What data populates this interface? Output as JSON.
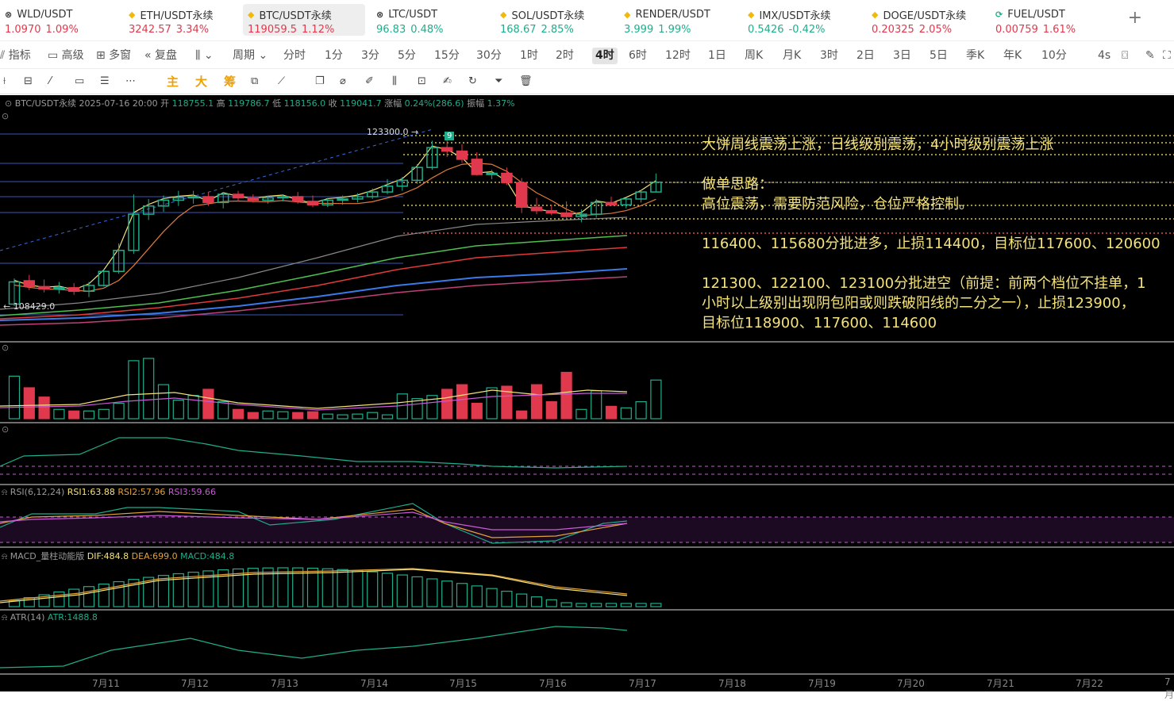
{
  "tickers": [
    {
      "name": "WLD/USDT",
      "price": "1.0970",
      "change": "1.09%",
      "icon": "⊗",
      "icon_color": "#333",
      "color": "#e0394d",
      "active": false
    },
    {
      "name": "ETH/USDT永续",
      "price": "3242.57",
      "change": "3.34%",
      "icon": "◆",
      "icon_color": "#f0b90b",
      "color": "#e0394d",
      "active": false
    },
    {
      "name": "BTC/USDT永续",
      "price": "119059.5",
      "change": "1.12%",
      "icon": "◆",
      "icon_color": "#f0b90b",
      "color": "#e0394d",
      "active": true
    },
    {
      "name": "LTC/USDT",
      "price": "96.83",
      "change": "0.48%",
      "icon": "⊗",
      "icon_color": "#333",
      "color": "#1fad8b",
      "active": false
    },
    {
      "name": "SOL/USDT永续",
      "price": "168.67",
      "change": "2.85%",
      "icon": "◆",
      "icon_color": "#f0b90b",
      "color": "#1fad8b",
      "active": false
    },
    {
      "name": "RENDER/USDT",
      "price": "3.999",
      "change": "1.99%",
      "icon": "◆",
      "icon_color": "#f0b90b",
      "color": "#1fad8b",
      "active": false
    },
    {
      "name": "IMX/USDT永续",
      "price": "0.5426",
      "change": "-0.42%",
      "icon": "◆",
      "icon_color": "#f0b90b",
      "color": "#1fad8b",
      "active": false
    },
    {
      "name": "DOGE/USDT永续",
      "price": "0.20325",
      "change": "2.05%",
      "icon": "◆",
      "icon_color": "#f0b90b",
      "color": "#e0394d",
      "active": false
    },
    {
      "name": "FUEL/USDT",
      "price": "0.00759",
      "change": "1.61%",
      "icon": "⟳",
      "icon_color": "#1fad8b",
      "color": "#e0394d",
      "active": false
    }
  ],
  "toolbar_left": [
    {
      "icon": "⫽",
      "label": "指标"
    },
    {
      "icon": "▭",
      "label": "高级"
    },
    {
      "icon": "⊞",
      "label": "多窗"
    },
    {
      "icon": "«",
      "label": "复盘"
    },
    {
      "icon": "⫼",
      "label": "⌄"
    }
  ],
  "periods_label": "周期 ⌄",
  "timeframes": [
    "分时",
    "1分",
    "3分",
    "5分",
    "15分",
    "30分",
    "1时",
    "2时",
    "4时",
    "6时",
    "12时",
    "1日",
    "周K",
    "月K",
    "3时",
    "2日",
    "3日",
    "5日",
    "季K",
    "年K",
    "10分",
    "4s"
  ],
  "active_timeframe": "4时",
  "draw_labels": {
    "main": "主",
    "big": "大",
    "chip": "筹"
  },
  "legend": {
    "symbol": "BTC/USDT永续",
    "time": "2025-07-16 20:00",
    "open_label": "开",
    "open": "118755.1",
    "high_label": "高",
    "high": "119786.7",
    "low_label": "低",
    "low": "118156.0",
    "close_label": "收",
    "close": "119041.7",
    "change_label": "涨幅",
    "change": "0.24%(286.6)",
    "amp_label": "振幅",
    "amp": "1.37%"
  },
  "price_labels": {
    "high": "123300.0",
    "low": "108429.0",
    "candle_count": "9"
  },
  "annotation": {
    "line1": "大饼周线震荡上涨，日线级别震荡，4小时级别震荡上涨",
    "line2": "做单思路：",
    "line3": "高位震荡，需要防范风险，仓位严格控制。",
    "line4": "116400、115680分批进多，止损114400，目标位117600、120600",
    "line5": "121300、122100、123100分批进空（前提：前两个档位不挂单，1",
    "line6": "小时以上级别出现阴包阳或则跌破阳线的二分之一），止损123900，",
    "line7": "目标位118900、117600、114600"
  },
  "rsi": {
    "label": "RSI(6,12,24)",
    "rsi1": "RSI1:63.88",
    "rsi2": "RSI2:57.96",
    "rsi3": "RSI3:59.66"
  },
  "macd": {
    "label": "MACD_量柱动能版",
    "dif": "DIF:484.8",
    "dea": "DEA:699.0",
    "macd": "MACD:484.8"
  },
  "atr": {
    "label": "ATR(14)",
    "value": "ATR:1488.8"
  },
  "xaxis": [
    "7月11",
    "7月12",
    "7月13",
    "7月14",
    "7月15",
    "7月16",
    "7月17",
    "7月18",
    "7月19",
    "7月20",
    "7月21",
    "7月22",
    "7月"
  ],
  "candles": [
    {
      "o": 108600,
      "h": 110800,
      "l": 108429,
      "c": 110500
    },
    {
      "o": 110600,
      "h": 111100,
      "l": 109800,
      "c": 110100
    },
    {
      "o": 110100,
      "h": 110700,
      "l": 109600,
      "c": 109900
    },
    {
      "o": 109900,
      "h": 110500,
      "l": 109500,
      "c": 110000
    },
    {
      "o": 110000,
      "h": 110400,
      "l": 109400,
      "c": 109700
    },
    {
      "o": 109700,
      "h": 110500,
      "l": 109200,
      "c": 110200
    },
    {
      "o": 110200,
      "h": 111600,
      "l": 110100,
      "c": 111400
    },
    {
      "o": 111400,
      "h": 113800,
      "l": 111200,
      "c": 113200
    },
    {
      "o": 113200,
      "h": 118000,
      "l": 112900,
      "c": 116300
    },
    {
      "o": 116300,
      "h": 117600,
      "l": 115800,
      "c": 117000
    },
    {
      "o": 117000,
      "h": 117900,
      "l": 116500,
      "c": 117500
    },
    {
      "o": 117500,
      "h": 118300,
      "l": 117000,
      "c": 117700
    },
    {
      "o": 117700,
      "h": 118300,
      "l": 117200,
      "c": 117800
    },
    {
      "o": 117800,
      "h": 118200,
      "l": 117000,
      "c": 117300
    },
    {
      "o": 117300,
      "h": 118200,
      "l": 116800,
      "c": 118000
    },
    {
      "o": 118000,
      "h": 118300,
      "l": 117400,
      "c": 117700
    },
    {
      "o": 117700,
      "h": 118000,
      "l": 117300,
      "c": 117500
    },
    {
      "o": 117500,
      "h": 117900,
      "l": 117200,
      "c": 117700
    },
    {
      "o": 117700,
      "h": 118000,
      "l": 117400,
      "c": 117800
    },
    {
      "o": 117800,
      "h": 118200,
      "l": 117200,
      "c": 117400
    },
    {
      "o": 117400,
      "h": 117900,
      "l": 116900,
      "c": 117100
    },
    {
      "o": 117100,
      "h": 117700,
      "l": 116900,
      "c": 117500
    },
    {
      "o": 117500,
      "h": 117900,
      "l": 117100,
      "c": 117600
    },
    {
      "o": 117600,
      "h": 118100,
      "l": 117300,
      "c": 117800
    },
    {
      "o": 117800,
      "h": 118500,
      "l": 117600,
      "c": 118200
    },
    {
      "o": 118200,
      "h": 119300,
      "l": 118000,
      "c": 118700
    },
    {
      "o": 118700,
      "h": 119500,
      "l": 118300,
      "c": 119200
    },
    {
      "o": 119200,
      "h": 120600,
      "l": 118900,
      "c": 120300
    },
    {
      "o": 120300,
      "h": 122600,
      "l": 120100,
      "c": 122000
    },
    {
      "o": 122000,
      "h": 123300,
      "l": 121200,
      "c": 121700
    },
    {
      "o": 121700,
      "h": 122300,
      "l": 120700,
      "c": 121000
    },
    {
      "o": 121000,
      "h": 121600,
      "l": 119600,
      "c": 119700
    },
    {
      "o": 119700,
      "h": 120100,
      "l": 119300,
      "c": 119800
    },
    {
      "o": 119800,
      "h": 120300,
      "l": 118800,
      "c": 119000
    },
    {
      "o": 119000,
      "h": 119400,
      "l": 116400,
      "c": 116900
    },
    {
      "o": 116900,
      "h": 117700,
      "l": 116300,
      "c": 116600
    },
    {
      "o": 116600,
      "h": 117100,
      "l": 116200,
      "c": 116400
    },
    {
      "o": 116400,
      "h": 117400,
      "l": 115800,
      "c": 116100
    },
    {
      "o": 116100,
      "h": 116700,
      "l": 115600,
      "c": 116300
    },
    {
      "o": 116300,
      "h": 117600,
      "l": 116000,
      "c": 117300
    },
    {
      "o": 117300,
      "h": 117800,
      "l": 117000,
      "c": 117100
    },
    {
      "o": 117100,
      "h": 117700,
      "l": 116800,
      "c": 117600
    },
    {
      "o": 117600,
      "h": 118400,
      "l": 117300,
      "c": 118200
    },
    {
      "o": 118200,
      "h": 119786.7,
      "l": 118156,
      "c": 119041.7
    }
  ],
  "volumes": [
    55,
    40,
    28,
    12,
    10,
    10,
    12,
    20,
    75,
    78,
    44,
    24,
    30,
    38,
    22,
    12,
    8,
    10,
    9,
    8,
    9,
    6,
    5,
    6,
    8,
    5,
    32,
    26,
    30,
    38,
    44,
    20,
    40,
    42,
    10,
    44,
    22,
    60,
    12,
    36,
    16,
    14,
    22,
    50
  ]
}
